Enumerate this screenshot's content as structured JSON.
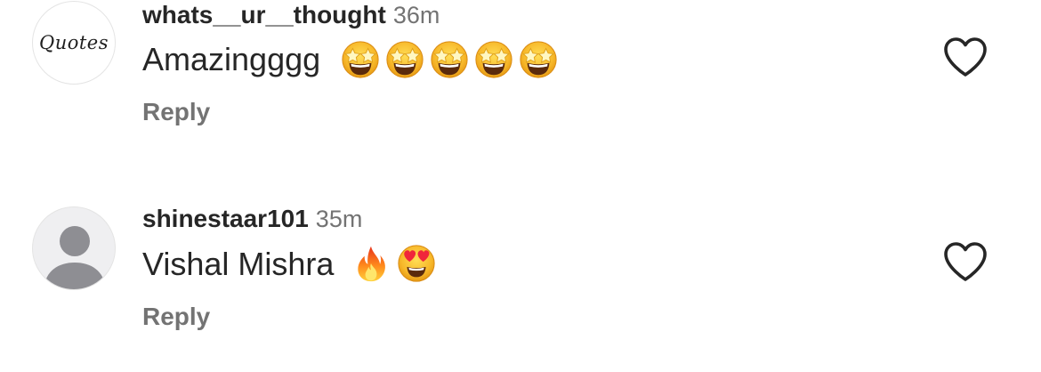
{
  "comments": [
    {
      "username": "whats__ur__thought",
      "time": "36m",
      "text": "Amazingggg",
      "avatar_text": "Quotes",
      "emojis": [
        "star-struck",
        "star-struck",
        "star-struck",
        "star-struck",
        "star-struck"
      ],
      "reply_label": "Reply",
      "like_icon": "heart-outline-icon"
    },
    {
      "username": "shinestaar101",
      "time": "35m",
      "text": "Vishal Mishra",
      "avatar_text": "",
      "emojis": [
        "fire",
        "heart-eyes"
      ],
      "reply_label": "Reply",
      "like_icon": "heart-outline-icon"
    }
  ],
  "colors": {
    "text": "#262626",
    "secondary": "#737373",
    "avatar_placeholder": "#8e8e93"
  }
}
